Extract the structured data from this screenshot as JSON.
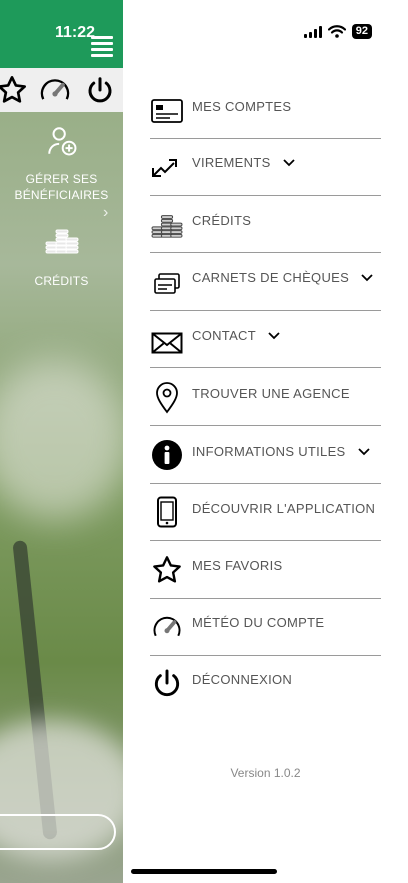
{
  "status_bar": {
    "time": "11:22",
    "battery": "92"
  },
  "background": {
    "items": [
      {
        "label": "GÉRER SES BÉNÉFICIAIRES",
        "icon": "add-user-icon"
      },
      {
        "label": "CRÉDITS",
        "icon": "coins-icon"
      }
    ]
  },
  "menu": {
    "items": [
      {
        "label": "MES COMPTES",
        "icon": "card-icon",
        "has_chevron": false
      },
      {
        "label": "VIREMENTS",
        "icon": "transfer-arrows-icon",
        "has_chevron": true
      },
      {
        "label": "CRÉDITS",
        "icon": "coins-icon",
        "has_chevron": false
      },
      {
        "label": "CARNETS DE CHÈQUES",
        "icon": "cheques-icon",
        "has_chevron": true
      },
      {
        "label": "CONTACT",
        "icon": "envelope-icon",
        "has_chevron": true
      },
      {
        "label": "TROUVER UNE AGENCE",
        "icon": "location-pin-icon",
        "has_chevron": false
      },
      {
        "label": "INFORMATIONS UTILES",
        "icon": "info-icon",
        "has_chevron": true
      },
      {
        "label": "DÉCOUVRIR L'APPLICATION",
        "icon": "phone-icon",
        "has_chevron": false
      },
      {
        "label": "MES FAVORIS",
        "icon": "star-icon",
        "has_chevron": false
      },
      {
        "label": "MÉTÉO DU COMPTE",
        "icon": "gauge-icon",
        "has_chevron": false
      },
      {
        "label": "DÉCONNEXION",
        "icon": "power-icon",
        "has_chevron": false
      }
    ]
  },
  "version": "Version 1.0.2",
  "colors": {
    "brand_green": "#1e9a5a",
    "menu_text": "#555555",
    "divider": "#9a9a9a"
  }
}
